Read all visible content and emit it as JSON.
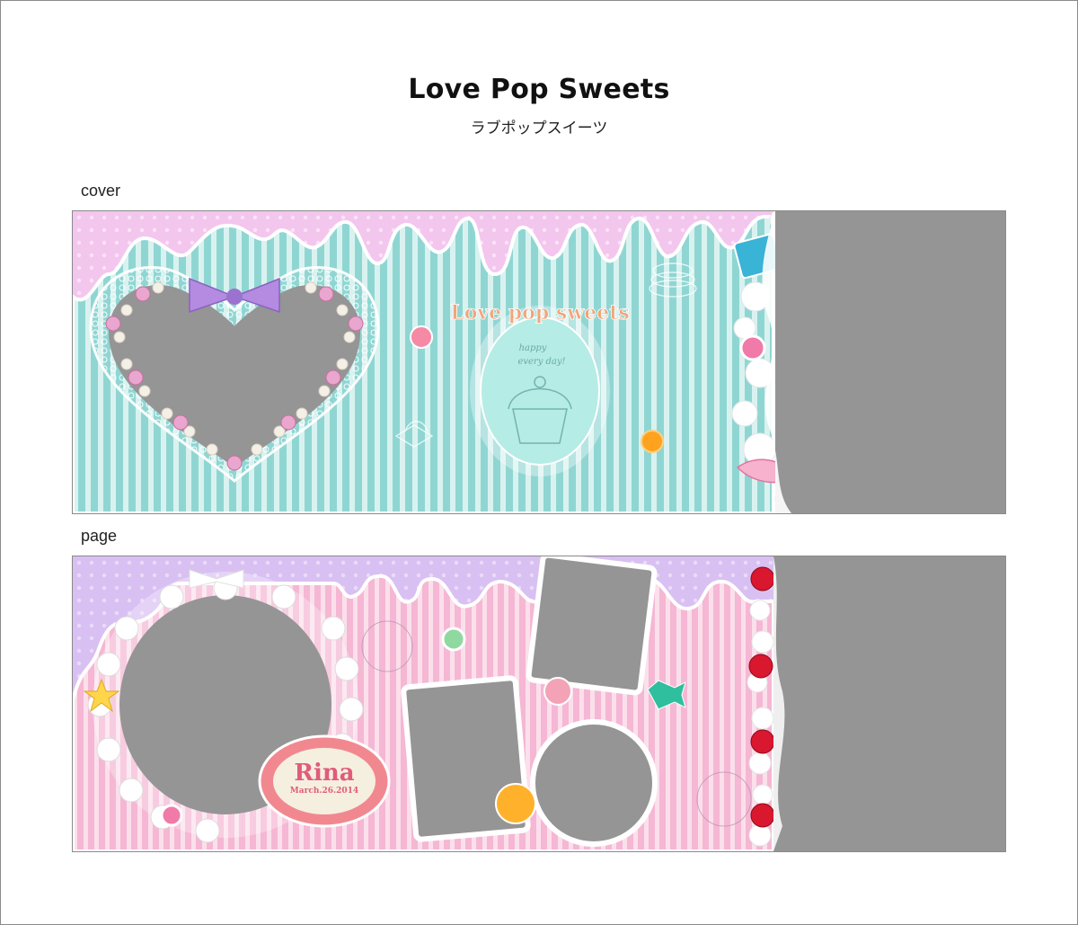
{
  "header": {
    "title": "Love Pop Sweets",
    "subtitle": "ラブポップスイーツ"
  },
  "sections": {
    "cover_label": "cover",
    "page_label": "page"
  },
  "cover": {
    "logo_text": "Love pop sweets",
    "script_text_1": "happy",
    "script_text_2": "every day!",
    "photo_slots": [
      "heart-frame",
      "back-cover-area"
    ]
  },
  "page": {
    "name_tag": "Rina",
    "date_tag": "March.26.2014",
    "photo_slots": [
      "round-lace-frame",
      "stamp-frame-left",
      "stamp-frame-top",
      "scallop-circle-frame",
      "right-page-area"
    ]
  },
  "colors": {
    "mint_stripe": "#8fd6d3",
    "pink_dots": "#f3c6ee",
    "pink_stripe": "#f5b7d3",
    "lavender_dots": "#d9c0f2",
    "photo_gray": "#959595",
    "ribbon_purple": "#b48be0",
    "logo_peach": "#f1a57a",
    "cherry_red": "#d9172e"
  }
}
